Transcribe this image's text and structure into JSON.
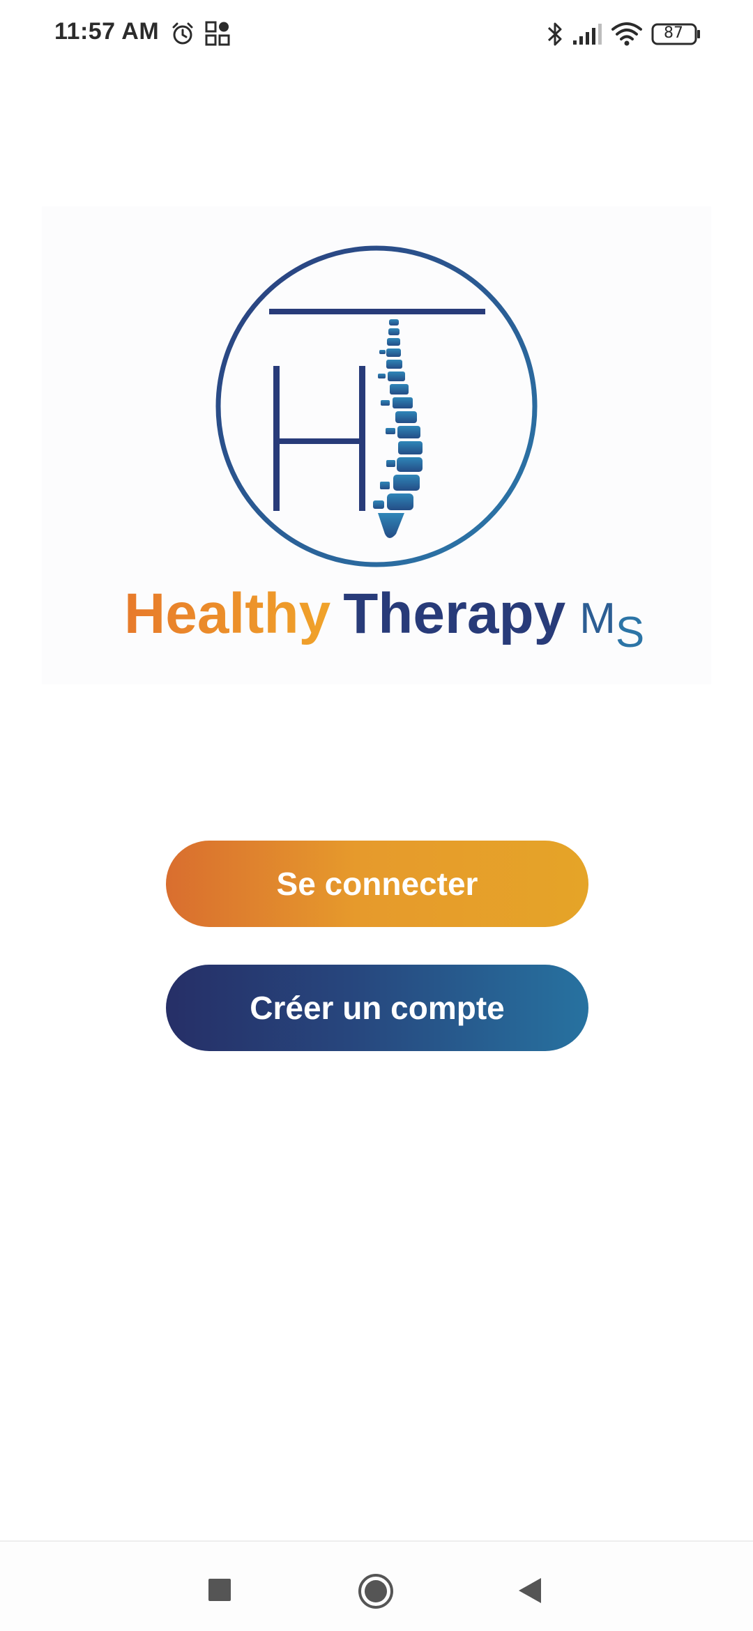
{
  "status_bar": {
    "time": "11:57 AM",
    "battery": "87",
    "icons": [
      "alarm-icon",
      "app-grid-icon",
      "bluetooth-icon",
      "cell-signal-icon",
      "wifi-icon",
      "battery-icon"
    ]
  },
  "logo": {
    "monogram": "HT",
    "word1": "Healthy",
    "word2": "Therapy",
    "suffix_m": "M",
    "suffix_s": "S",
    "colors": {
      "orange": "#E8852B",
      "navy": "#283B79",
      "blue": "#2C74A6"
    }
  },
  "actions": {
    "login_label": "Se connecter",
    "register_label": "Créer un compte"
  },
  "nav_bar": {
    "icons": [
      "recent-apps-icon",
      "home-icon",
      "back-icon"
    ]
  }
}
